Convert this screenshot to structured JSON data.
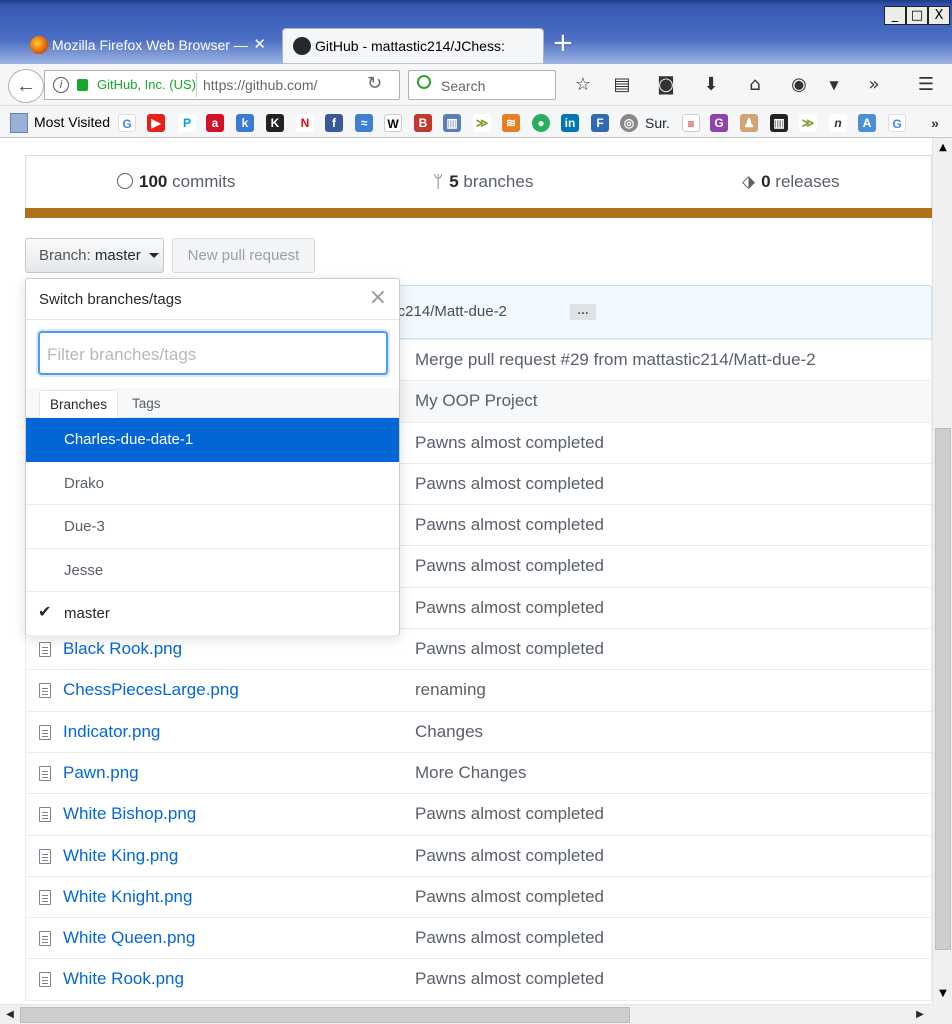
{
  "browser": {
    "tabs": [
      {
        "title": "Mozilla Firefox Web Browser — ",
        "close": "✕"
      },
      {
        "title": "GitHub - mattastic214/JChess: ",
        "close": ""
      }
    ],
    "new_tab": "+",
    "identity": "GitHub, Inc. (US)",
    "url": "https://github.com/",
    "search_placeholder": "Search",
    "bookmarks_most_visited": "Most Visited",
    "bookmark_sur": "Sur.",
    "window_buttons": [
      "_",
      "□",
      "X"
    ],
    "overflow": "»"
  },
  "repo": {
    "commits_count": "100",
    "commits_label": "commits",
    "branches_count": "5",
    "branches_label": "branches",
    "releases_count": "0",
    "releases_label": "releases",
    "language_color": "#b07219"
  },
  "actions": {
    "branch_prefix": "Branch:",
    "branch_name": "master",
    "new_pr": "New pull request"
  },
  "commit_tease": {
    "text": "ttastic214/Matt-due-2",
    "ellipsis": "…"
  },
  "dropdown": {
    "title": "Switch branches/tags",
    "close": "×",
    "filter_placeholder": "Filter branches/tags",
    "tab_branches": "Branches",
    "tab_tags": "Tags",
    "branches": [
      {
        "name": "Charles-due-date-1"
      },
      {
        "name": "Drako"
      },
      {
        "name": "Due-3"
      },
      {
        "name": "Jesse"
      },
      {
        "name": "master"
      }
    ],
    "check": "✔"
  },
  "files": [
    {
      "name": "",
      "message": "Merge pull request #29 from mattastic214/Matt-due-2"
    },
    {
      "name": "",
      "message": "My OOP Project"
    },
    {
      "name": "",
      "message": "Pawns almost completed"
    },
    {
      "name": "",
      "message": "Pawns almost completed"
    },
    {
      "name": "",
      "message": "Pawns almost completed"
    },
    {
      "name": "",
      "message": "Pawns almost completed"
    },
    {
      "name": "",
      "message": "Pawns almost completed"
    },
    {
      "name": "Black Rook.png",
      "message": "Pawns almost completed"
    },
    {
      "name": "ChessPiecesLarge.png",
      "message": "renaming"
    },
    {
      "name": "Indicator.png",
      "message": "Changes"
    },
    {
      "name": "Pawn.png",
      "message": "More Changes"
    },
    {
      "name": "White Bishop.png",
      "message": "Pawns almost completed"
    },
    {
      "name": "White King.png",
      "message": "Pawns almost completed"
    },
    {
      "name": "White Knight.png",
      "message": "Pawns almost completed"
    },
    {
      "name": "White Queen.png",
      "message": "Pawns almost completed"
    },
    {
      "name": "White Rook.png",
      "message": "Pawns almost completed"
    }
  ]
}
